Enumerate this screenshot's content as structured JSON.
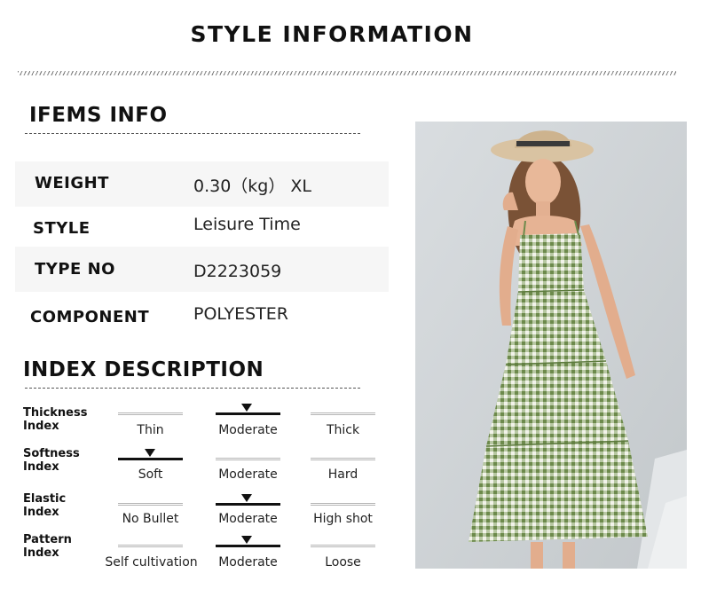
{
  "header": {
    "title": "STYLE INFORMATION"
  },
  "items_info": {
    "title": "IFEMS INFO",
    "rows": [
      {
        "label": "WEIGHT",
        "value": "0.30（kg） XL"
      },
      {
        "label": "STYLE",
        "value": "Leisure Time"
      },
      {
        "label": "TYPE NO",
        "value": "D2223059"
      },
      {
        "label": "COMPONENT",
        "value": "POLYESTER"
      }
    ]
  },
  "index_description": {
    "title": "INDEX DESCRIPTION",
    "rows": [
      {
        "label_line1": "Thickness",
        "label_line2": "Index",
        "options": [
          "Thin",
          "Moderate",
          "Thick"
        ],
        "selected": 1
      },
      {
        "label_line1": "Softness",
        "label_line2": "Index",
        "options": [
          "Soft",
          "Moderate",
          "Hard"
        ],
        "selected": 0
      },
      {
        "label_line1": "Elastic",
        "label_line2": "Index",
        "options": [
          "No Bullet",
          "Moderate",
          "High shot"
        ],
        "selected": 1
      },
      {
        "label_line1": "Pattern",
        "label_line2": "Index",
        "options": [
          "Self cultivation",
          "Moderate",
          "Loose"
        ],
        "selected": 1
      }
    ]
  },
  "colors": {
    "dress_green": "#7e9a5e",
    "background_wall": "#d3d7da"
  }
}
